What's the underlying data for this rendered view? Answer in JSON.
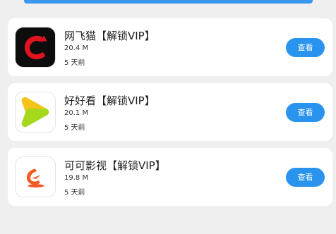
{
  "colors": {
    "accent": "#2a93ee",
    "background": "#efefef"
  },
  "apps": [
    {
      "icon": "wangfeimao-app-icon",
      "title": "网飞猫【解锁VIP】",
      "size": "20.4 M",
      "time": "5 天前",
      "button": "查看"
    },
    {
      "icon": "haohaokan-app-icon",
      "title": "好好看【解锁VIP】",
      "size": "20.1 M",
      "time": "5 天前",
      "button": "查看"
    },
    {
      "icon": "kekeyingshi-app-icon",
      "title": "可可影视【解锁VIP】",
      "size": "19.8 M",
      "time": "5 天前",
      "button": "查看"
    }
  ]
}
